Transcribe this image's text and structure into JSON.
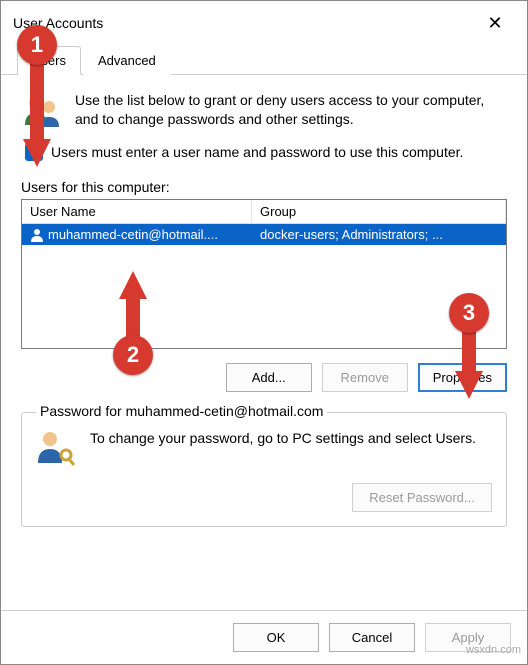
{
  "window": {
    "title": "User Accounts"
  },
  "tabs": {
    "users": "Users",
    "advanced": "Advanced"
  },
  "intro": "Use the list below to grant or deny users access to your computer, and to change passwords and other settings.",
  "checkbox": {
    "label": "Users must enter a user name and password to use this computer."
  },
  "users_section": {
    "label": "Users for this computer:",
    "columns": {
      "username": "User Name",
      "group": "Group"
    },
    "row": {
      "username": "muhammed-cetin@hotmail....",
      "group": "docker-users; Administrators; ..."
    }
  },
  "buttons": {
    "add": "Add...",
    "remove": "Remove",
    "properties": "Properties",
    "reset_password": "Reset Password...",
    "ok": "OK",
    "cancel": "Cancel",
    "apply": "Apply"
  },
  "password_section": {
    "legend": "Password for muhammed-cetin@hotmail.com",
    "text": "To change your password, go to PC settings and select Users."
  },
  "annotations": {
    "b1": "1",
    "b2": "2",
    "b3": "3"
  },
  "watermark": "wsxdn.com"
}
